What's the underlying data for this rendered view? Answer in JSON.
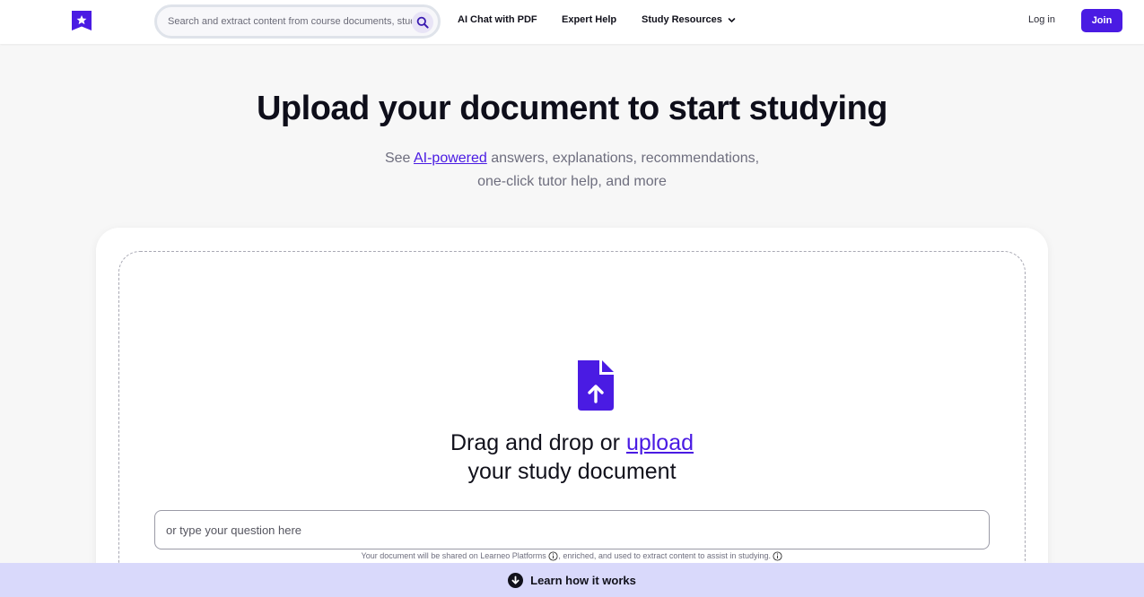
{
  "header": {
    "search_placeholder": "Search and extract content from course documents, study guides, and more",
    "nav": {
      "ai_chat": "AI Chat with PDF",
      "expert_help": "Expert Help",
      "study_resources": "Study Resources"
    },
    "login": "Log in",
    "join": "Join"
  },
  "hero": {
    "title": "Upload your document to start studying",
    "sub_prefix": "See ",
    "sub_link": "AI-powered",
    "sub_line1_rest": " answers, explanations, recommendations,",
    "sub_line2": "one-click tutor help, and more"
  },
  "upload": {
    "drag_prefix": "Drag and drop or ",
    "upload_link": "upload",
    "drag_line2": "your study document",
    "question_placeholder": "or type your question here",
    "disclaimer_part1": "Your document will be shared on Learneo Platforms",
    "disclaimer_part2": ", enriched, and used to extract content to assist in studying."
  },
  "banner": {
    "label": "Learn how it works"
  },
  "icons": {
    "logo": "star-bookmark-icon",
    "search": "search-icon",
    "dropdown": "chevron-down-icon",
    "document": "document-upload-icon",
    "info": "info-icon",
    "learn": "arrow-down-circle-icon"
  },
  "colors": {
    "brand": "#4a1be3",
    "banner_bg": "#d9d9fb",
    "page_bg": "#f7f7f7"
  }
}
